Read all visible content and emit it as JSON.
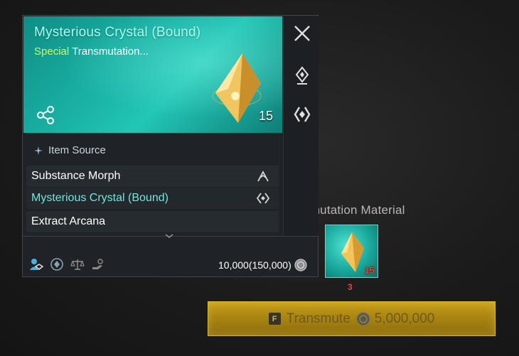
{
  "tooltip": {
    "item_name": "Mysterious Crystal (Bound)",
    "grade": "Special",
    "item_type": "Transmutation...",
    "stack_count": "15",
    "source_header": "Item Source",
    "sources": [
      {
        "label": "Substance Morph",
        "icon": "morph-icon"
      },
      {
        "label": "Mysterious Crystal (Bound)",
        "icon": "crystal-transmute-icon"
      },
      {
        "label": "Extract Arcana",
        "icon": "extract-icon"
      }
    ],
    "price": "10,000(150,000)",
    "colors": {
      "accent": "#6fe8dd",
      "grade": "#c8ff6a",
      "hero_bg": "#1ab3a6"
    }
  },
  "material": {
    "title": "Transmutation Material",
    "slot_count": "15",
    "required": "3"
  },
  "transmute": {
    "key": "F",
    "label": "Transmute",
    "cost": "5,000,000",
    "color": "#b08b14"
  }
}
